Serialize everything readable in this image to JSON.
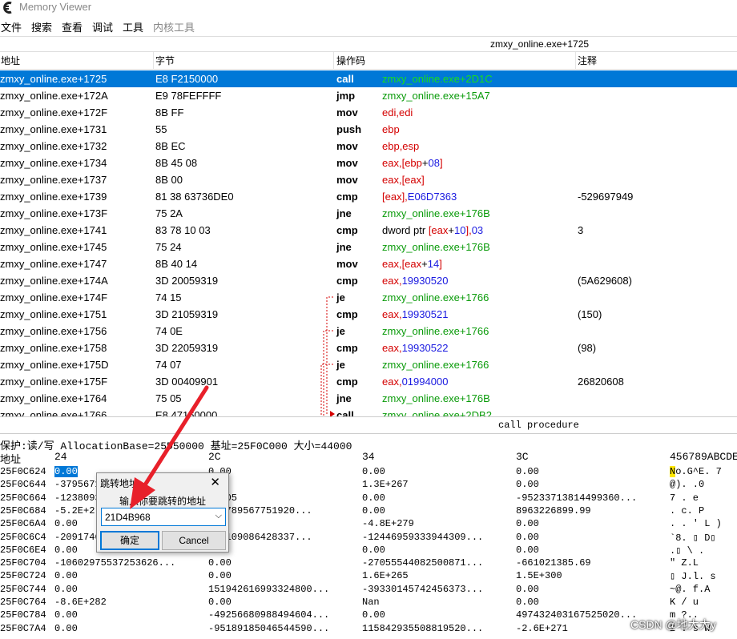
{
  "window": {
    "title": "Memory Viewer"
  },
  "menu": [
    "文件",
    "搜索",
    "查看",
    "调试",
    "工具",
    "内核工具"
  ],
  "disasm": {
    "current_address": "zmxy_online.exe+1725",
    "columns": [
      "地址",
      "字节",
      "操作码",
      "注释"
    ],
    "rows": [
      {
        "addr": "zmxy_online.exe+1725",
        "bytes": "E8 F2150000",
        "op": "call",
        "args": [
          {
            "t": "zmxy_online.exe+2D1C",
            "c": "green"
          }
        ],
        "comment": ""
      },
      {
        "addr": "zmxy_online.exe+172A",
        "bytes": "E9 78FEFFFF",
        "op": "jmp",
        "args": [
          {
            "t": "zmxy_online.exe+15A7",
            "c": "green"
          }
        ],
        "comment": ""
      },
      {
        "addr": "zmxy_online.exe+172F",
        "bytes": "8B FF",
        "op": "mov",
        "args": [
          {
            "t": "edi,edi",
            "c": "red"
          }
        ],
        "comment": ""
      },
      {
        "addr": "zmxy_online.exe+1731",
        "bytes": "55",
        "op": "push",
        "args": [
          {
            "t": "ebp",
            "c": "red"
          }
        ],
        "comment": ""
      },
      {
        "addr": "zmxy_online.exe+1732",
        "bytes": "8B EC",
        "op": "mov",
        "args": [
          {
            "t": "ebp,esp",
            "c": "red"
          }
        ],
        "comment": ""
      },
      {
        "addr": "zmxy_online.exe+1734",
        "bytes": "8B 45 08",
        "op": "mov",
        "args": [
          {
            "t": "eax,[",
            "c": "red"
          },
          {
            "t": "ebp",
            "c": "red"
          },
          {
            "t": "+",
            "c": "blk"
          },
          {
            "t": "08",
            "c": "blue"
          },
          {
            "t": "]",
            "c": "red"
          }
        ],
        "comment": ""
      },
      {
        "addr": "zmxy_online.exe+1737",
        "bytes": "8B 00",
        "op": "mov",
        "args": [
          {
            "t": "eax,[eax]",
            "c": "red"
          }
        ],
        "comment": ""
      },
      {
        "addr": "zmxy_online.exe+1739",
        "bytes": "81 38 63736DE0",
        "op": "cmp",
        "args": [
          {
            "t": "[eax],",
            "c": "red"
          },
          {
            "t": "E06D7363",
            "c": "blue"
          }
        ],
        "comment": "-529697949"
      },
      {
        "addr": "zmxy_online.exe+173F",
        "bytes": "75 2A",
        "op": "jne",
        "args": [
          {
            "t": "zmxy_online.exe+176B",
            "c": "green"
          }
        ],
        "comment": ""
      },
      {
        "addr": "zmxy_online.exe+1741",
        "bytes": "83 78 10 03",
        "op": "cmp",
        "args": [
          {
            "t": "dword ptr ",
            "c": "blk"
          },
          {
            "t": "[eax",
            "c": "red"
          },
          {
            "t": "+",
            "c": "blk"
          },
          {
            "t": "10",
            "c": "blue"
          },
          {
            "t": "],",
            "c": "red"
          },
          {
            "t": "03",
            "c": "blue"
          }
        ],
        "comment": "3"
      },
      {
        "addr": "zmxy_online.exe+1745",
        "bytes": "75 24",
        "op": "jne",
        "args": [
          {
            "t": "zmxy_online.exe+176B",
            "c": "green"
          }
        ],
        "comment": ""
      },
      {
        "addr": "zmxy_online.exe+1747",
        "bytes": "8B 40 14",
        "op": "mov",
        "args": [
          {
            "t": "eax,[eax",
            "c": "red"
          },
          {
            "t": "+",
            "c": "blk"
          },
          {
            "t": "14",
            "c": "blue"
          },
          {
            "t": "]",
            "c": "red"
          }
        ],
        "comment": ""
      },
      {
        "addr": "zmxy_online.exe+174A",
        "bytes": "3D 20059319",
        "op": "cmp",
        "args": [
          {
            "t": "eax,",
            "c": "red"
          },
          {
            "t": "19930520",
            "c": "blue"
          }
        ],
        "comment": "(5A629608)"
      },
      {
        "addr": "zmxy_online.exe+174F",
        "bytes": "74 15",
        "op": "je",
        "args": [
          {
            "t": "zmxy_online.exe+1766",
            "c": "green"
          }
        ],
        "comment": ""
      },
      {
        "addr": "zmxy_online.exe+1751",
        "bytes": "3D 21059319",
        "op": "cmp",
        "args": [
          {
            "t": "eax,",
            "c": "red"
          },
          {
            "t": "19930521",
            "c": "blue"
          }
        ],
        "comment": "(150)"
      },
      {
        "addr": "zmxy_online.exe+1756",
        "bytes": "74 0E",
        "op": "je",
        "args": [
          {
            "t": "zmxy_online.exe+1766",
            "c": "green"
          }
        ],
        "comment": ""
      },
      {
        "addr": "zmxy_online.exe+1758",
        "bytes": "3D 22059319",
        "op": "cmp",
        "args": [
          {
            "t": "eax,",
            "c": "red"
          },
          {
            "t": "19930522",
            "c": "blue"
          }
        ],
        "comment": "(98)"
      },
      {
        "addr": "zmxy_online.exe+175D",
        "bytes": "74 07",
        "op": "je",
        "args": [
          {
            "t": "zmxy_online.exe+1766",
            "c": "green"
          }
        ],
        "comment": ""
      },
      {
        "addr": "zmxy_online.exe+175F",
        "bytes": "3D 00409901",
        "op": "cmp",
        "args": [
          {
            "t": "eax,",
            "c": "red"
          },
          {
            "t": "01994000",
            "c": "blue"
          }
        ],
        "comment": "26820608"
      },
      {
        "addr": "zmxy_online.exe+1764",
        "bytes": "75 05",
        "op": "jne",
        "args": [
          {
            "t": "zmxy_online.exe+176B",
            "c": "green"
          }
        ],
        "comment": ""
      },
      {
        "addr": "zmxy_online.exe+1766",
        "bytes": "E8 47160000",
        "op": "call",
        "args": [
          {
            "t": "zmxy_online.exe+2DB2",
            "c": "green"
          }
        ],
        "comment": ""
      }
    ],
    "status": "call procedure"
  },
  "hexview": {
    "info": "保护:读/写  AllocationBase=25D50000 基址=25F0C000 大小=44000",
    "columns": [
      "地址",
      "24",
      "2C",
      "34",
      "3C",
      "456789ABCDE"
    ],
    "rows": [
      [
        "25F0C624",
        "0.00",
        "0.00",
        "0.00",
        "0.00",
        "No.G^E. 7 "
      ],
      [
        "25F0C644",
        "-3795671",
        "",
        "1.3E+267",
        "0.00",
        "@).  .0"
      ],
      [
        "25F0C664",
        "-12380930",
        "E+305",
        "0.00",
        "-95233713814499360...",
        " 7  .  e"
      ],
      [
        "25F0C684",
        "-5.2E+2",
        "141789567751920...",
        "0.00",
        "8963226899.99",
        ".    c. P"
      ],
      [
        "25F0C6A4",
        "0.00",
        "",
        "-4.8E+279",
        "0.00",
        ". . ' L )"
      ],
      [
        "25F0C6C4",
        "-2091746",
        "471109086428337...",
        "-12446959333944309...",
        "0.00",
        "`8. ▯   D▯"
      ],
      [
        "25F0C6E4",
        "0.00",
        "",
        "0.00",
        "0.00",
        "  .▯    \\ ."
      ],
      [
        "25F0C704",
        "-10602975537253626...",
        "0.00",
        "-27055544082500871...",
        "-661021385.69",
        " \" Z.L"
      ],
      [
        "25F0C724",
        "0.00",
        "0.00",
        "1.6E+265",
        "1.5E+300",
        "▯   J.l.  s"
      ],
      [
        "25F0C744",
        "0.00",
        "151942616993324800...",
        "-39330145742456373...",
        "0.00",
        "~@.    f.A"
      ],
      [
        "25F0C764",
        "-8.6E+282",
        "0.00",
        "Nan",
        "0.00",
        " K /    u"
      ],
      [
        "25F0C784",
        "0.00",
        "-49256680988494604...",
        "0.00",
        "497432403167525020...",
        "m     ?.. "
      ],
      [
        "25F0C7A4",
        "0.00",
        "-95189185046544590...",
        "115842935508819520...",
        "-2.6E+271",
        "2  .   s W"
      ]
    ]
  },
  "goto_dialog": {
    "title": "跳转地址",
    "prompt": "输入你要跳转的地址",
    "value": "21D4B968",
    "ok_label": "确定",
    "cancel_label": "Cancel"
  },
  "watermark": "CSDN @地大大y",
  "colors": {
    "selection": "#0078d7",
    "annotation_arrow": "#e8202a",
    "jump_line": "#d40000"
  }
}
